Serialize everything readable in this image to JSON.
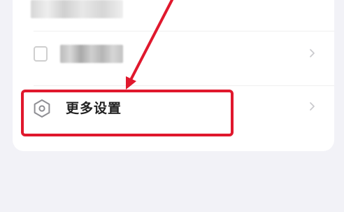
{
  "settings_list": {
    "items": [
      {
        "label": "",
        "blurred": true
      },
      {
        "label": "",
        "blurred": true,
        "icon": "blurred-icon"
      },
      {
        "label": "更多设置",
        "icon": "hexagon-settings-icon"
      }
    ]
  },
  "annotation": {
    "color": "#e0182d"
  }
}
